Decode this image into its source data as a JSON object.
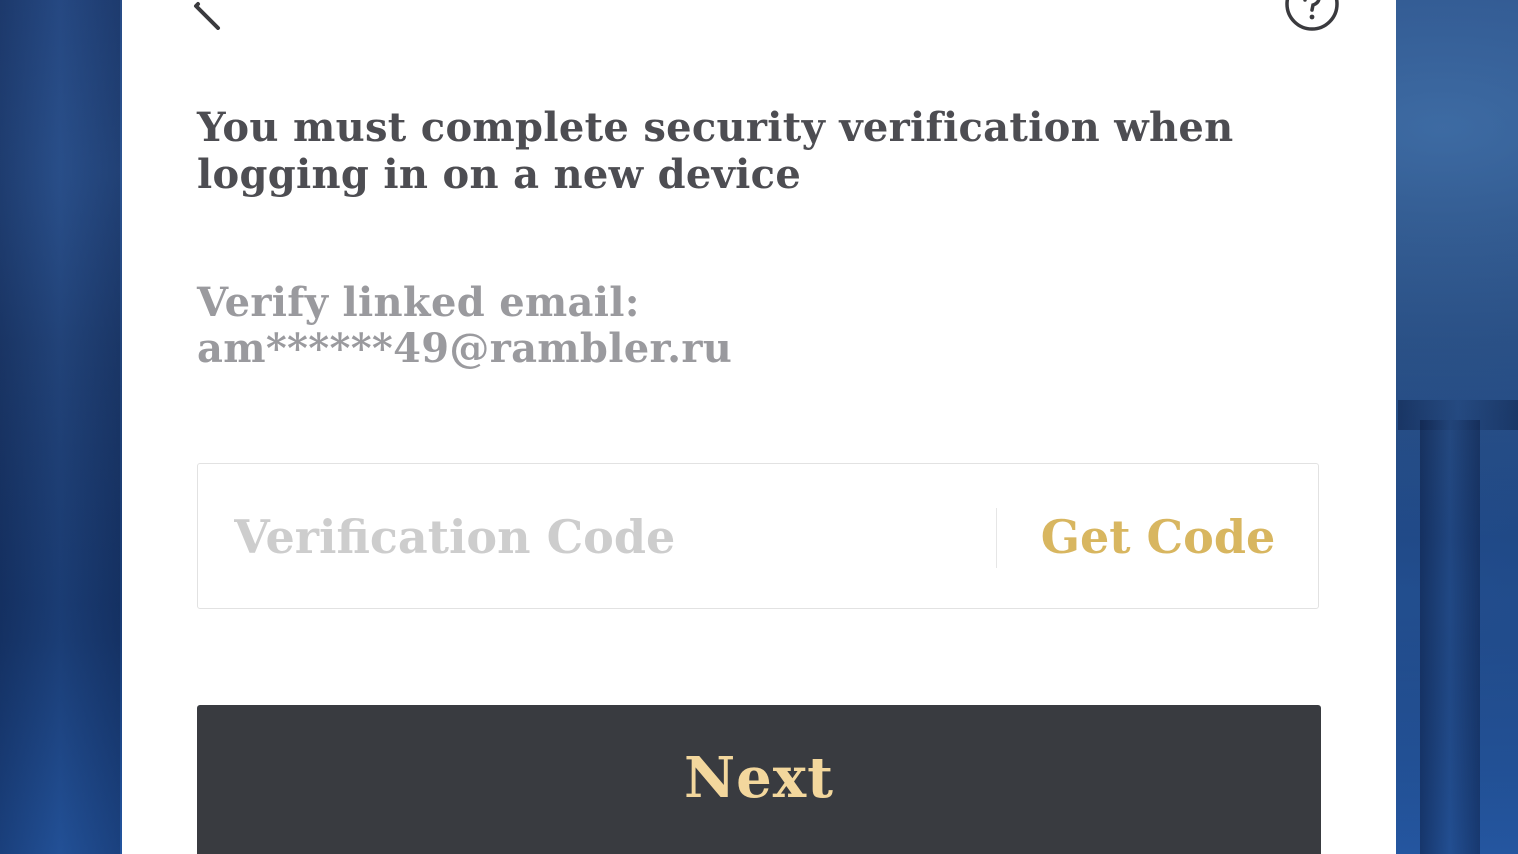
{
  "header": {
    "back_icon": "chevron-left-icon",
    "help_icon": "question-circle-icon"
  },
  "verification": {
    "title": "You must complete security verification when logging in on a new device",
    "email_label": "Verify linked email:",
    "email_value": "am******49@rambler.ru",
    "code_placeholder": "Verification Code",
    "code_value": "",
    "get_code_label": "Get Code",
    "next_label": "Next"
  },
  "colors": {
    "accent_gold": "#d8b660",
    "button_bg": "#393b40",
    "button_text": "#f3d79d",
    "title_text": "#4d4d52",
    "muted_text": "#9a9a9e"
  }
}
